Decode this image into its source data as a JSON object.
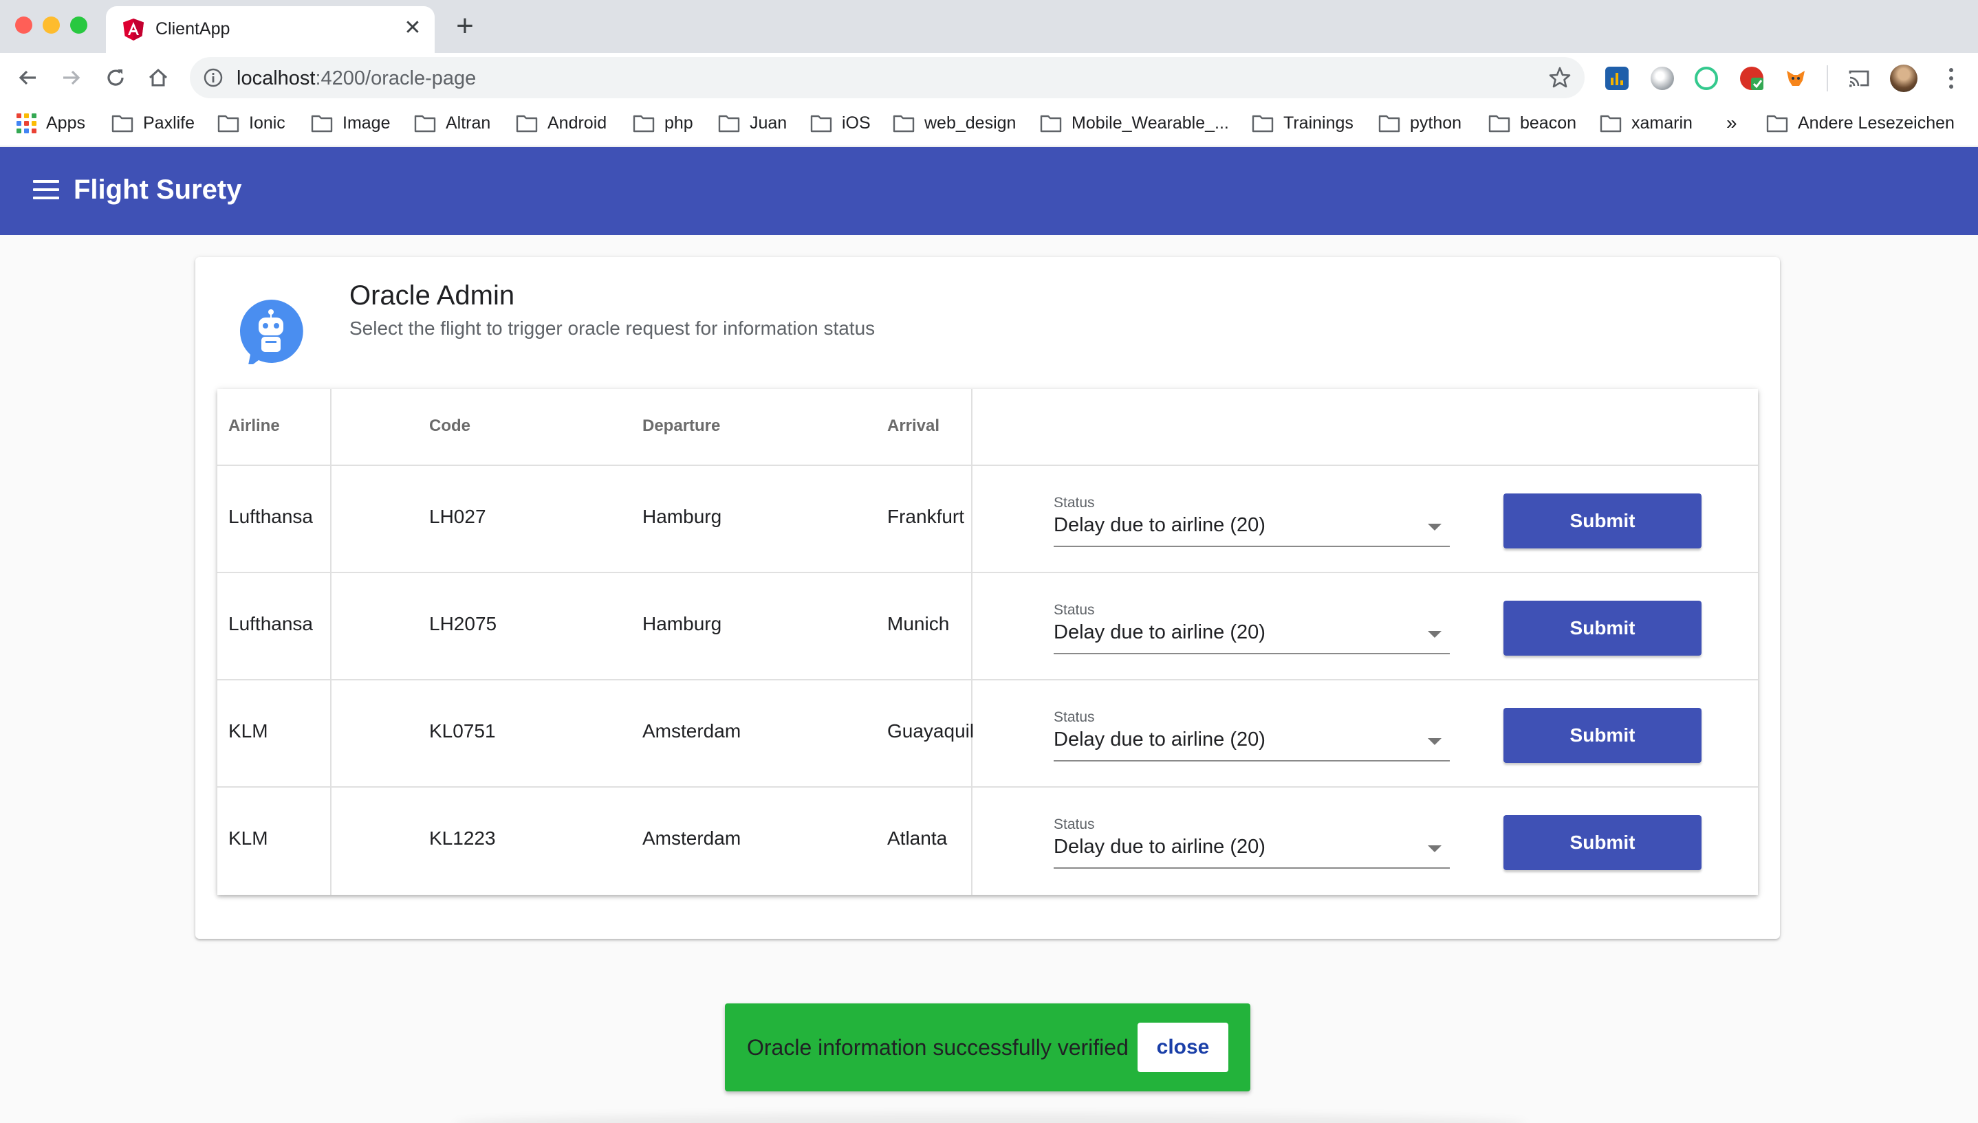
{
  "browser": {
    "tab_title": "ClientApp",
    "url_host": "localhost",
    "url_rest": ":4200/oracle-page",
    "bookmarks": [
      "Apps",
      "Paxlife",
      "Ionic",
      "Image",
      "Altran",
      "Android",
      "php",
      "Juan",
      "iOS",
      "web_design",
      "Mobile_Wearable_...",
      "Trainings",
      "python",
      "beacon",
      "xamarin"
    ],
    "bookmarks_overflow": "»",
    "other_bookmarks": "Andere Lesezeichen"
  },
  "app": {
    "title": "Flight Surety",
    "brand_color": "#3f51b5"
  },
  "card": {
    "title": "Oracle Admin",
    "subtitle": "Select the flight to trigger oracle request for information status",
    "avatar_icon": "robot-icon"
  },
  "table": {
    "headers": [
      "Airline",
      "Code",
      "Departure",
      "Arrival"
    ],
    "rows": [
      {
        "airline": "Lufthansa",
        "code": "LH027",
        "departure": "Hamburg",
        "arrival": "Frankfurt",
        "status_label": "Status",
        "status": "Delay due to airline (20)",
        "button": "Submit"
      },
      {
        "airline": "Lufthansa",
        "code": "LH2075",
        "departure": "Hamburg",
        "arrival": "Munich",
        "status_label": "Status",
        "status": "Delay due to airline (20)",
        "button": "Submit"
      },
      {
        "airline": "KLM",
        "code": "KL0751",
        "departure": "Amsterdam",
        "arrival": "Guayaquil",
        "status_label": "Status",
        "status": "Delay due to airline (20)",
        "button": "Submit"
      },
      {
        "airline": "KLM",
        "code": "KL1223",
        "departure": "Amsterdam",
        "arrival": "Atlanta",
        "status_label": "Status",
        "status": "Delay due to airline (20)",
        "button": "Submit"
      }
    ]
  },
  "snackbar": {
    "message": "Oracle information successfully verified",
    "action": "close",
    "color": "#23b33b"
  }
}
